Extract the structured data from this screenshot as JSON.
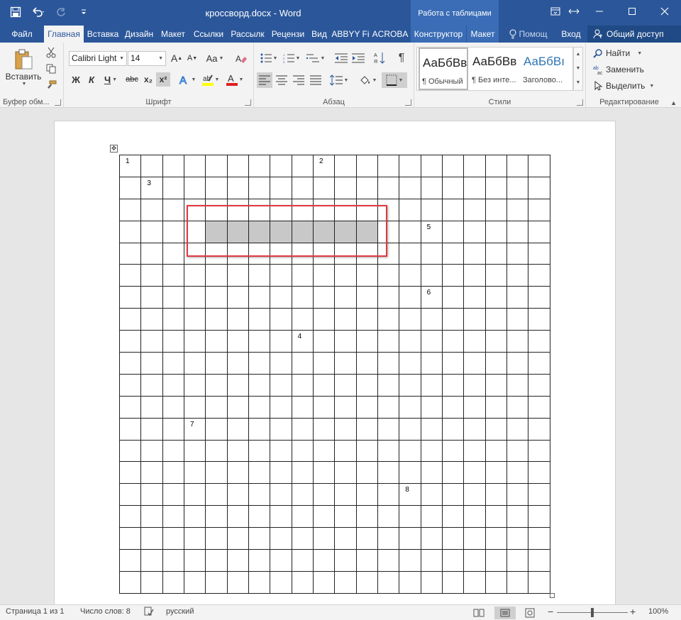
{
  "title_bar": {
    "document_title": "кроссворд.docx - Word",
    "context_group": "Работа с таблицами"
  },
  "tabs": [
    {
      "label": "Файл"
    },
    {
      "label": "Главная"
    },
    {
      "label": "Вставка"
    },
    {
      "label": "Дизайн"
    },
    {
      "label": "Макет"
    },
    {
      "label": "Ссылки"
    },
    {
      "label": "Рассылк"
    },
    {
      "label": "Рецензи"
    },
    {
      "label": "Вид"
    },
    {
      "label": "ABBYY Fi"
    },
    {
      "label": "ACROBA"
    },
    {
      "label": "Конструктор"
    },
    {
      "label": "Макет"
    },
    {
      "label": "Помощ"
    },
    {
      "label": "Вход"
    }
  ],
  "share_label": "Общий доступ",
  "ribbon": {
    "clipboard": {
      "label": "Буфер обм...",
      "paste_label": "Вставить"
    },
    "font": {
      "label": "Шрифт",
      "font_name": "Calibri Light",
      "font_size": "14",
      "bold": "Ж",
      "italic": "К",
      "underline": "Ч",
      "strike": "abc",
      "subscript": "x₂",
      "superscript": "x²",
      "case": "Aa"
    },
    "paragraph": {
      "label": "Абзац"
    },
    "styles": {
      "label": "Стили",
      "items": [
        {
          "preview": "АаБбВв",
          "name": "¶ Обычный",
          "color": "#000000"
        },
        {
          "preview": "АаБбВв",
          "name": "¶ Без инте...",
          "color": "#000000"
        },
        {
          "preview": "АаБбВı",
          "name": "Заголово...",
          "color": "#2e74b5"
        }
      ]
    },
    "editing": {
      "label": "Редактирование",
      "find": "Найти",
      "replace": "Заменить",
      "select": "Выделить"
    }
  },
  "crossword": {
    "rows": 20,
    "cols": 20,
    "numbers": [
      {
        "row": 0,
        "col": 0,
        "label": "1"
      },
      {
        "row": 0,
        "col": 9,
        "label": "2"
      },
      {
        "row": 1,
        "col": 1,
        "label": "3"
      },
      {
        "row": 3,
        "col": 14,
        "label": "5"
      },
      {
        "row": 6,
        "col": 14,
        "label": "6"
      },
      {
        "row": 8,
        "col": 8,
        "label": "4"
      },
      {
        "row": 12,
        "col": 3,
        "label": "7"
      },
      {
        "row": 15,
        "col": 13,
        "label": "8"
      }
    ],
    "shaded_row": 3,
    "shaded_cols": [
      4,
      5,
      6,
      7,
      8,
      9,
      10,
      11
    ]
  },
  "status_bar": {
    "page": "Страница 1 из 1",
    "words": "Число слов: 8",
    "language": "русский",
    "zoom": "100%"
  },
  "colors": {
    "accent": "#2b579a",
    "highlight": "#e0393e",
    "shade": "#c8c8c8"
  }
}
